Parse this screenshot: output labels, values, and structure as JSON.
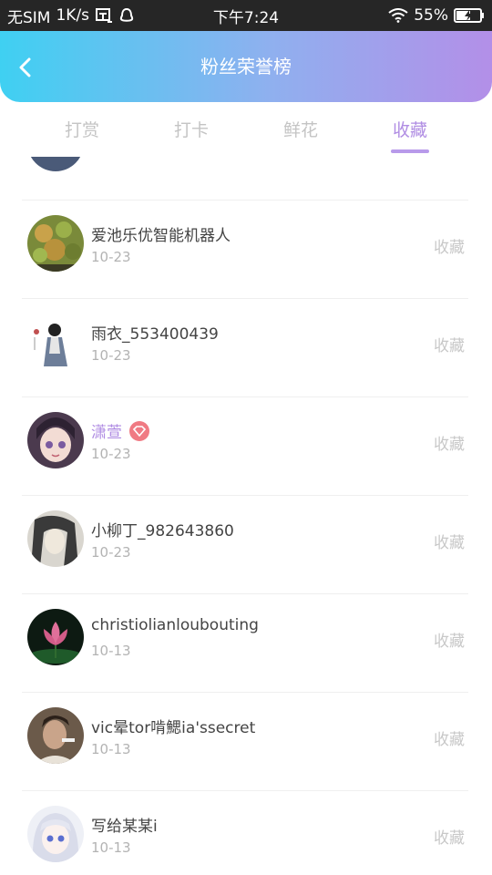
{
  "status_bar": {
    "carrier": "无SIM",
    "speed": "1K/s",
    "time": "下午7:24",
    "battery": "55%",
    "icons": [
      "notification-icon",
      "qq-penguin-icon",
      "wifi-icon",
      "battery-charging-icon"
    ]
  },
  "header": {
    "title": "粉丝荣誉榜",
    "back_icon": "chevron-left-icon",
    "gradient": [
      "#3fd0f2",
      "#b38fe8"
    ]
  },
  "tabs": [
    {
      "label": "打赏",
      "active": false
    },
    {
      "label": "打卡",
      "active": false
    },
    {
      "label": "鲜花",
      "active": false
    },
    {
      "label": "收藏",
      "active": true
    }
  ],
  "colors": {
    "accent": "#b08de3",
    "muted": "#c4c4c4",
    "badge": "#f07a83"
  },
  "users": [
    {
      "name": "爱池乐优智能机器人",
      "date": "10-23",
      "action": "收藏",
      "vip": false,
      "avatar": "food-photo-avatar"
    },
    {
      "name": "雨衣_553400439",
      "date": "10-23",
      "action": "收藏",
      "vip": false,
      "avatar": "ink-painting-avatar"
    },
    {
      "name": "潇萱",
      "date": "10-23",
      "action": "收藏",
      "vip": true,
      "avatar": "anime-girl-avatar"
    },
    {
      "name": "小柳丁_982643860",
      "date": "10-23",
      "action": "收藏",
      "vip": false,
      "avatar": "sketch-portrait-avatar"
    },
    {
      "name": "christiolianloubouting",
      "date": "10-13",
      "action": "收藏",
      "vip": false,
      "avatar": "lotus-flower-avatar"
    },
    {
      "name": "vic晕tor啃鰓ia'ssecret",
      "date": "10-13",
      "action": "收藏",
      "vip": false,
      "avatar": "man-photo-avatar"
    },
    {
      "name": "写给某某i",
      "date": "10-13",
      "action": "收藏",
      "vip": false,
      "avatar": "anime-white-hair-avatar"
    }
  ]
}
